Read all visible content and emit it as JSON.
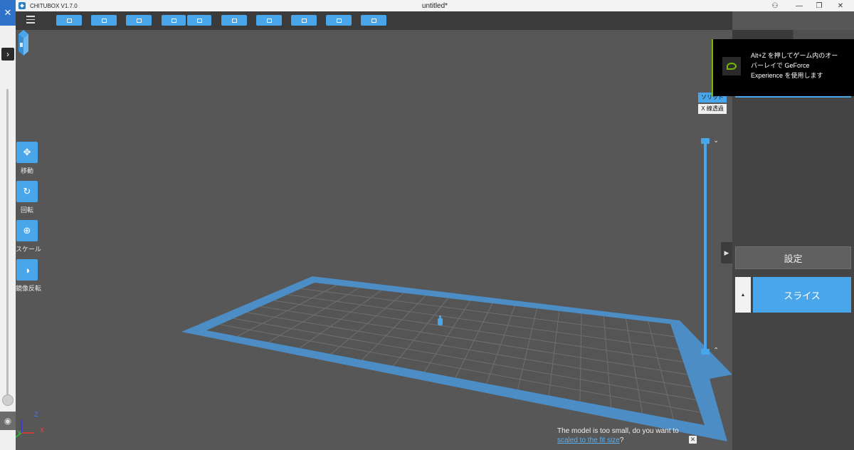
{
  "window": {
    "app_name": "CHITUBOX V1.7.0",
    "doc_title": "untitled*",
    "controls": {
      "account": "⚇",
      "minimize": "—",
      "restore": "❐",
      "close": "✕"
    }
  },
  "outer": {
    "close_glyph": "✕",
    "expand_glyph": "›",
    "eye_glyph": "◉"
  },
  "toolbar": {
    "menu_icon": "menu-icon",
    "buttons": [
      "open-file-icon",
      "save-icon",
      "select-all-icon",
      "undo-icon",
      "redo-icon",
      "auto-layout-icon",
      "supports-icon",
      "hollow-icon",
      "drill-icon",
      "export-icon"
    ]
  },
  "tools": [
    {
      "label": "移動",
      "icon": "move-icon",
      "glyph": "✥"
    },
    {
      "label": "回転",
      "icon": "rotate-icon",
      "glyph": "↻"
    },
    {
      "label": "スケール",
      "icon": "scale-icon",
      "glyph": "⊕"
    },
    {
      "label": "鏡像反転",
      "icon": "mirror-icon",
      "glyph": "◑"
    }
  ],
  "view": {
    "solid_label": "ソリッド",
    "xray_label": "X 線透過"
  },
  "slider": {
    "up_glyph": "⌄",
    "down_glyph": "⌃"
  },
  "notice": {
    "text": "The model is too small, do you want to",
    "link": "scaled to the fit size",
    "suffix": "?",
    "close_glyph": "✕"
  },
  "panel": {
    "expand_glyph": "▶",
    "settings_label": "設定",
    "slice_label": "スライス",
    "slice_menu_glyph": "▲"
  },
  "overlay": {
    "line1": "Alt+Z を押してゲーム内のオー",
    "line2": "バーレイで GeForce",
    "line3": "Experience を使用します"
  },
  "axes": {
    "x": "X",
    "y": "Y",
    "z": "Z"
  },
  "colors": {
    "accent": "#4aa6ea",
    "viewport": "#575757",
    "plate_border": "#4b8dc4",
    "nvidia_green": "#76b900"
  }
}
